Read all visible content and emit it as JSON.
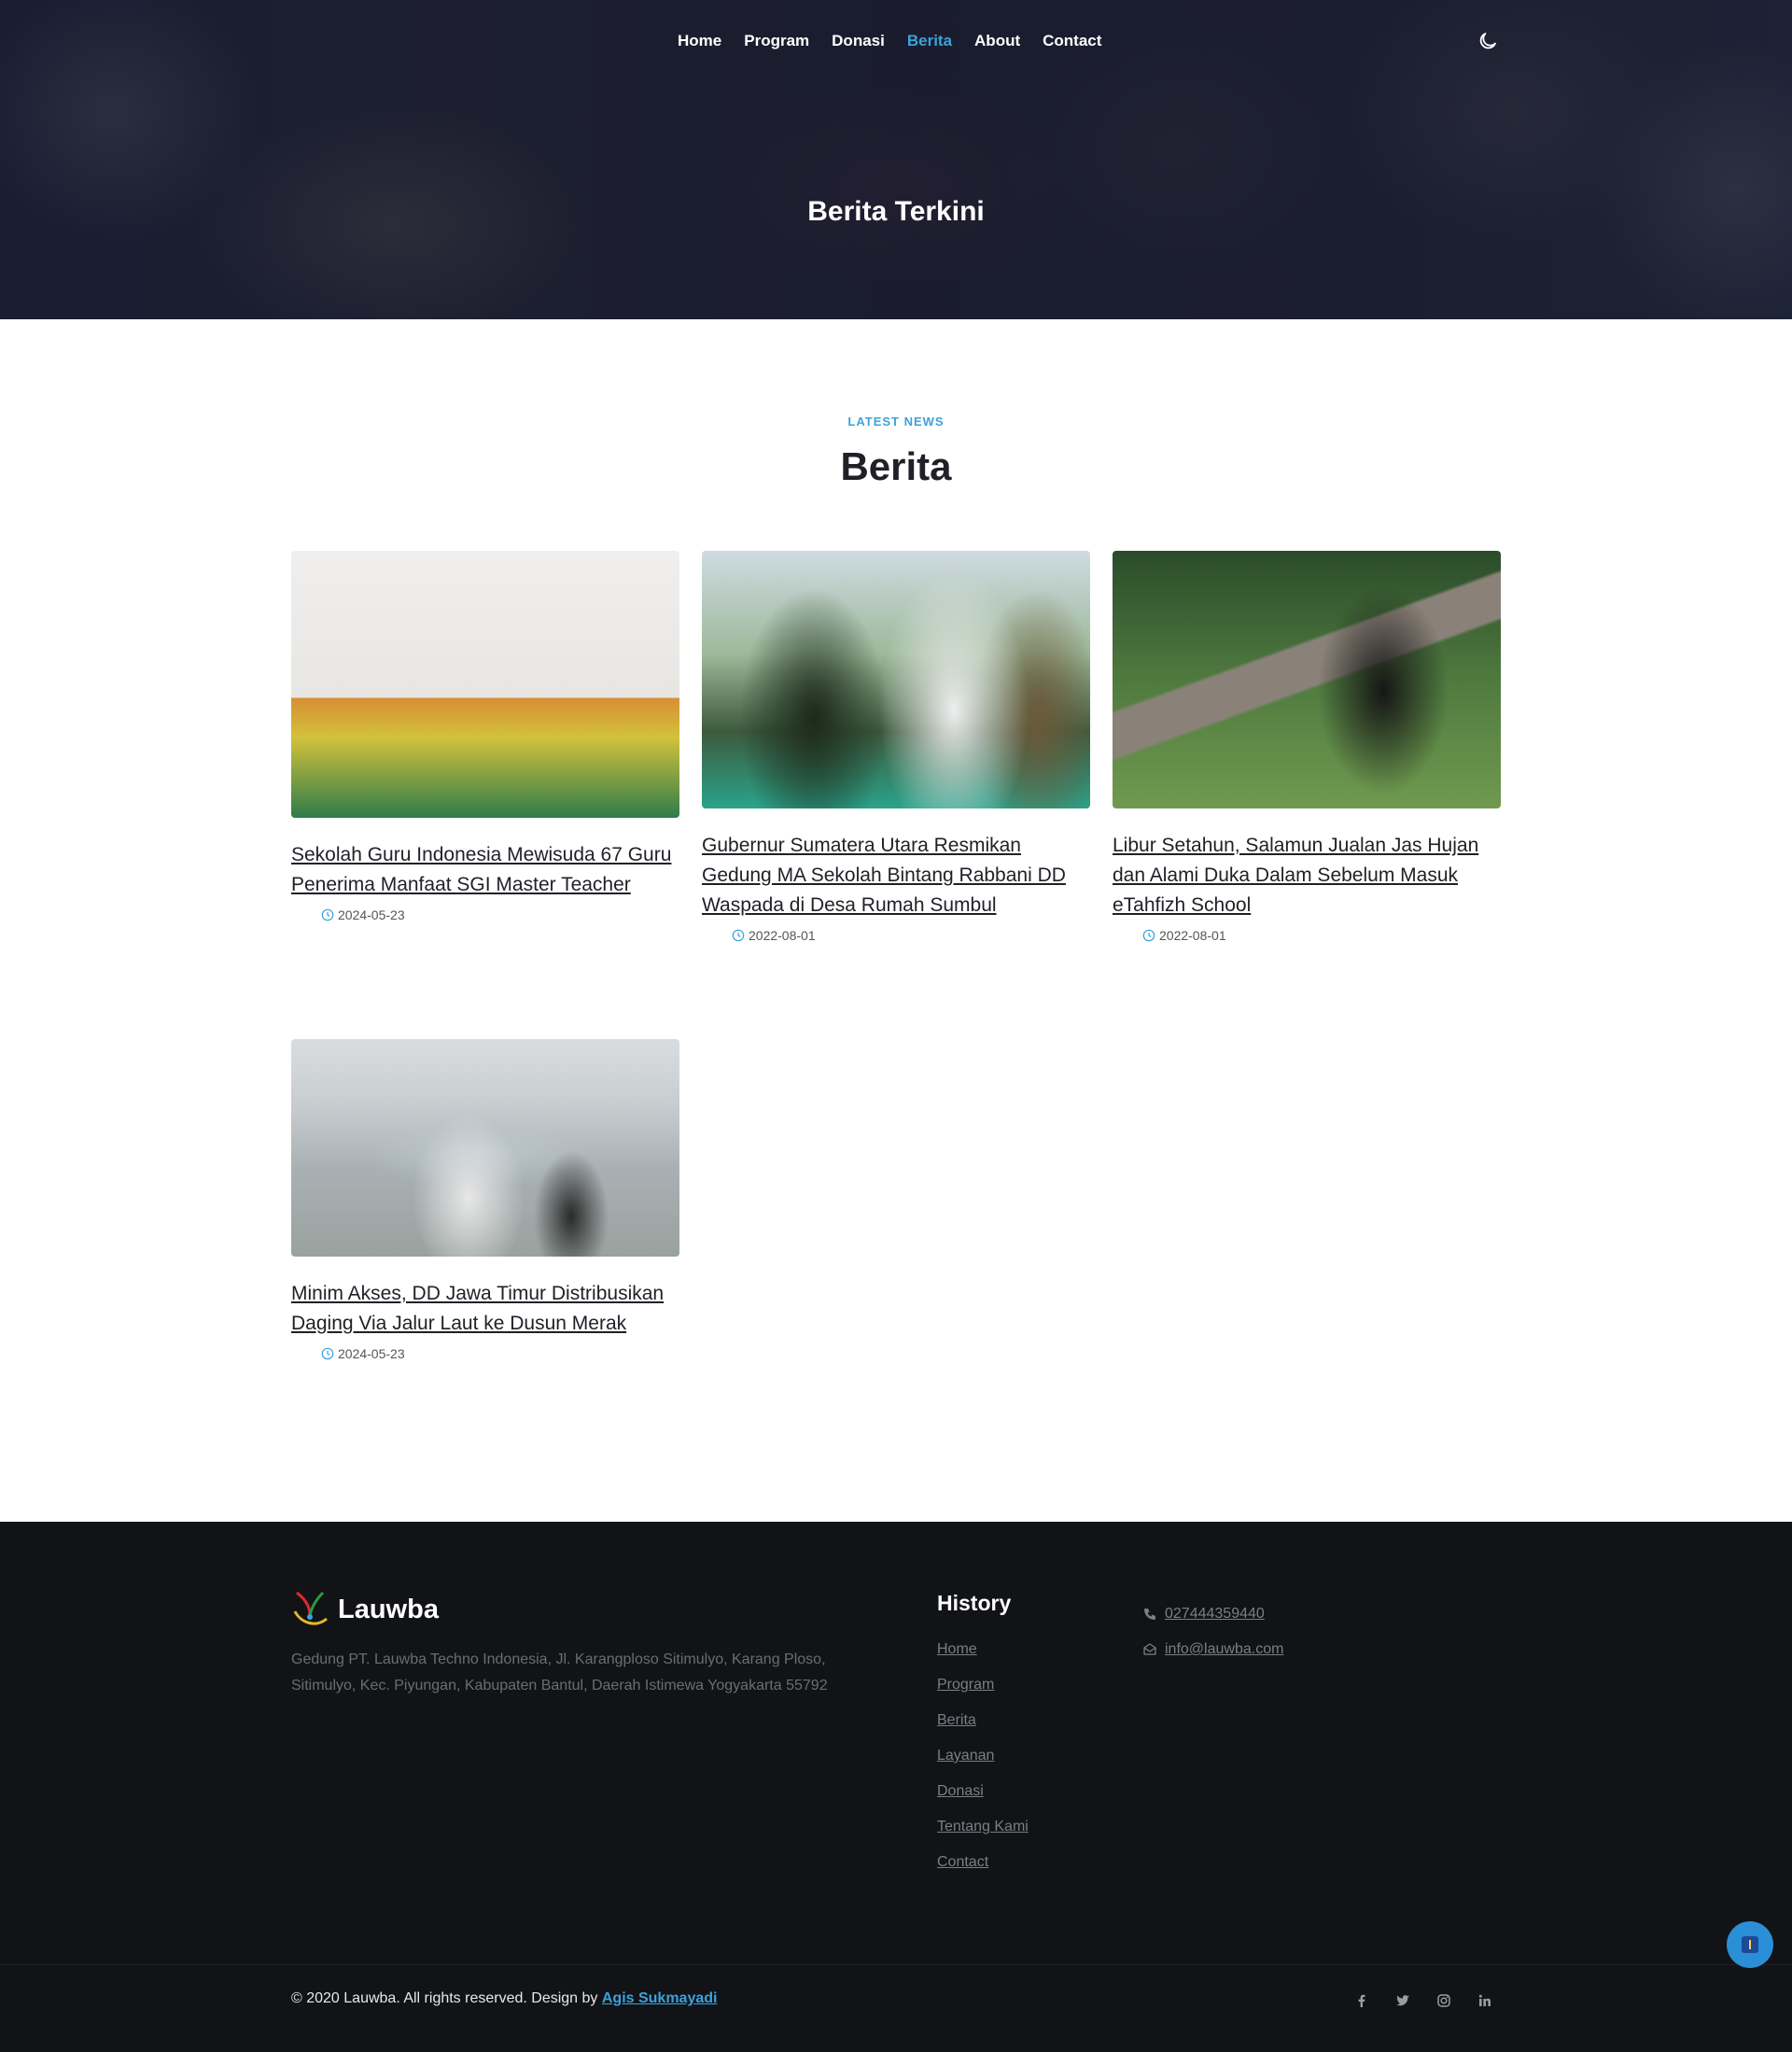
{
  "nav": {
    "items": [
      "Home",
      "Program",
      "Donasi",
      "Berita",
      "About",
      "Contact"
    ],
    "active": "Berita"
  },
  "theme_toggle_icon": "moon-icon",
  "hero": {
    "title": "Berita Terkini"
  },
  "section": {
    "subtitle": "LATEST NEWS",
    "title": "Berita"
  },
  "news": [
    {
      "title": "Sekolah Guru Indonesia Mewisuda 67 Guru Penerima Manfaat SGI Master Teacher",
      "date": "2024-05-23",
      "image": "graduation-ceremony-photo"
    },
    {
      "title": "Gubernur Sumatera Utara Resmikan Gedung MA Sekolah Bintang Rabbani DD Waspada di Desa Rumah Sumbul",
      "date": "2022-08-01",
      "image": "ribbon-cutting-photo"
    },
    {
      "title": "Libur Setahun, Salamun Jualan Jas Hujan dan Alami Duka Dalam Sebelum Masuk eTahfizh School",
      "date": "2022-08-01",
      "image": "student-reading-under-tree-photo"
    },
    {
      "title": "Minim Akses, DD Jawa Timur Distribusikan Daging Via Jalur Laut ke Dusun Merak",
      "date": "2024-05-23",
      "image": "boat-on-shore-photo"
    }
  ],
  "footer": {
    "brand": "Lauwba",
    "address": "Gedung PT. Lauwba Techno Indonesia, Jl. Karangploso Sitimulyo, Karang Ploso, Sitimulyo, Kec. Piyungan, Kabupaten Bantul, Daerah Istimewa Yogyakarta 55792",
    "links_heading": "History",
    "links": [
      "Home",
      "Program",
      "Berita",
      "Layanan",
      "Donasi",
      "Tentang Kami",
      "Contact"
    ],
    "phone": "027444359440",
    "email": "info@lauwba.com",
    "copyright": "© 2020 Lauwba. All rights reserved. Design by ",
    "designer": "Agis Sukmayadi",
    "social": [
      "facebook-icon",
      "twitter-icon",
      "instagram-icon",
      "linkedin-icon"
    ]
  },
  "colors": {
    "accent": "#3aa3dc",
    "footer_bg": "#121317",
    "hero_overlay": "#121830"
  }
}
